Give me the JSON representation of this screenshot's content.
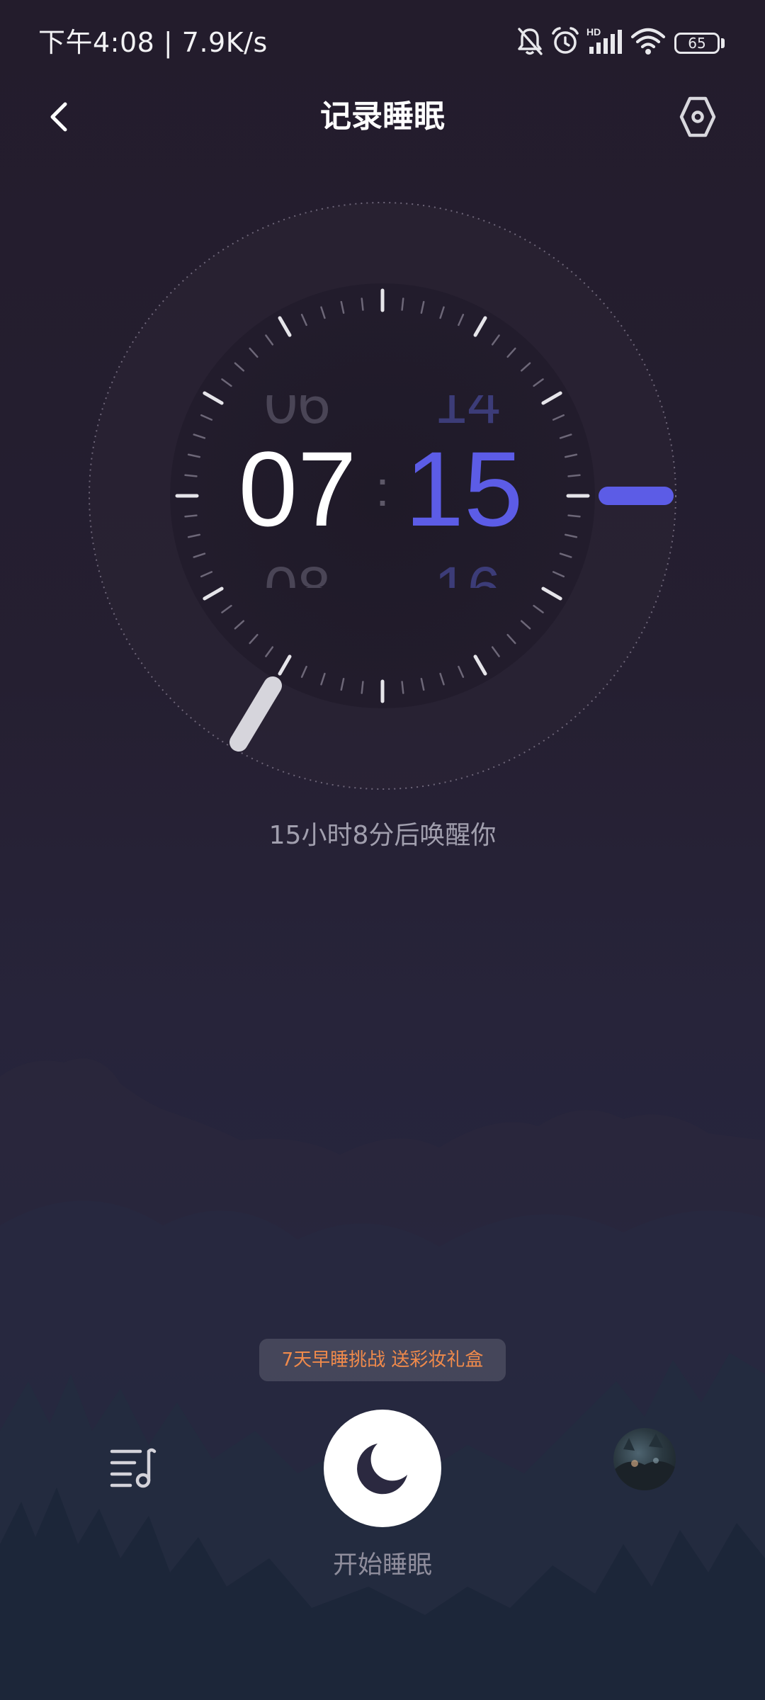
{
  "status_bar": {
    "time": "下午4:08 | 7.9K/s",
    "icons": [
      "mute-bell-icon",
      "alarm-clock-icon",
      "hd-signal-icon",
      "wifi-icon",
      "battery-icon"
    ],
    "hd_label": "HD",
    "battery_level": "65"
  },
  "header": {
    "title": "记录睡眠",
    "back_icon": "chevron-left-icon",
    "settings_icon": "hexagon-settings-icon"
  },
  "alarm": {
    "hour": "07",
    "minute": "15",
    "separator": ":",
    "hour_prev": "06",
    "hour_next": "08",
    "minute_prev": "14",
    "minute_next": "16",
    "wake_text": "15小时8分后唤醒你"
  },
  "colors": {
    "accent": "#5c5ce6",
    "promo_text": "#f08a4b",
    "background": "#251f31"
  },
  "promo": {
    "label": "7天早睡挑战 送彩妆礼盒"
  },
  "actions": {
    "start_sleep_label": "开始睡眠",
    "sleep_icon": "crescent-moon-icon",
    "music_icon": "music-list-icon",
    "avatar_icon": "avatar-image"
  }
}
